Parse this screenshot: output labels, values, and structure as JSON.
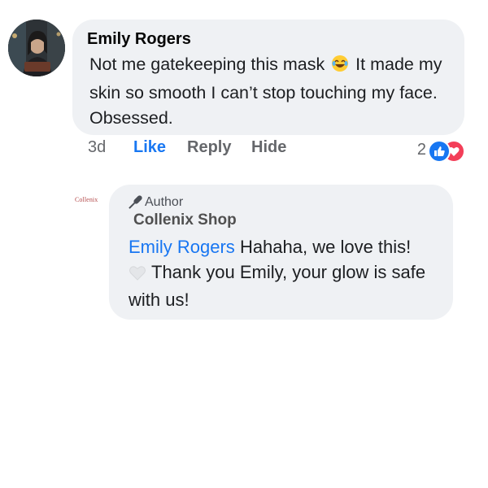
{
  "comment": {
    "author": "Emily Rogers",
    "text_before_emoji": "Not me gatekeeping this mask",
    "emoji": "laughing-tears-emoji",
    "text_after_emoji": "It made my skin so smooth I can’t stop touching my face. Obsessed."
  },
  "actions": {
    "time": "3d",
    "like": "Like",
    "reply": "Reply",
    "hide": "Hide"
  },
  "reactions": {
    "count": "2",
    "types": [
      "like",
      "love"
    ],
    "colors": {
      "like": "#1877f2",
      "love": "#f33e58"
    }
  },
  "reply": {
    "logo_text": "Collenix",
    "badge_label": "Author",
    "badge_icon": "microphone-icon",
    "author": "Collenix Shop",
    "mention": "Emily Rogers",
    "text_first": "Hahaha, we love this!",
    "heart_emoji": "white-heart-emoji",
    "text_second": "Thank you Emily, your glow is safe with us!"
  },
  "colors": {
    "bubble": "#eff1f4",
    "link_blue": "#1877f2",
    "muted": "#65676b"
  }
}
